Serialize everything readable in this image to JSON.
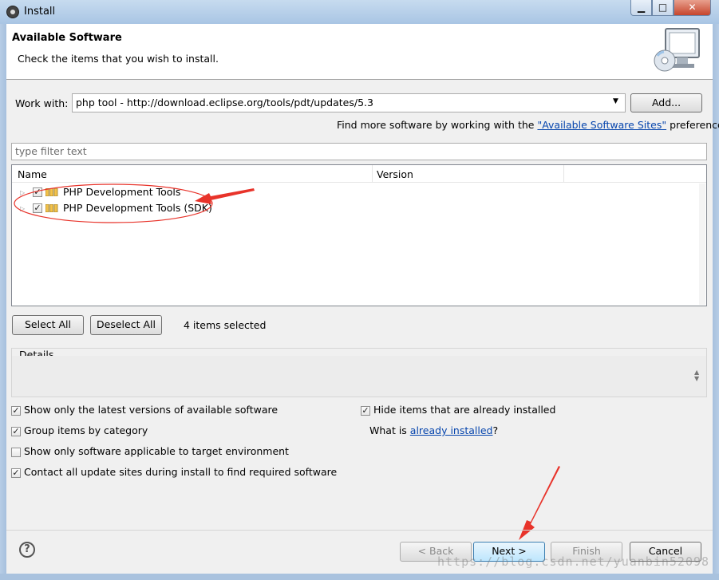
{
  "window": {
    "title": "Install",
    "min_glyph": "▁",
    "max_glyph": "□",
    "close_glyph": "✕"
  },
  "header": {
    "title": "Available Software",
    "subtitle": "Check the items that you wish to install.",
    "icon": "monitor-cd-icon"
  },
  "work_with": {
    "label": "Work with:",
    "value": "php tool - http://download.eclipse.org/tools/pdt/updates/5.3",
    "add_button": "Add...",
    "hint_prefix": "Find more software by working with the",
    "hint_link": "\"Available Software Sites\"",
    "hint_suffix": "preferences."
  },
  "filter": {
    "placeholder": "type filter text"
  },
  "table": {
    "columns": [
      "Name",
      "Version"
    ],
    "rows": [
      {
        "name": "PHP Development Tools",
        "checked": true
      },
      {
        "name": "PHP Development Tools (SDK)",
        "checked": true
      }
    ]
  },
  "selection": {
    "select_all": "Select All",
    "deselect_all": "Deselect All",
    "status": "4 items selected"
  },
  "details": {
    "label": "Details"
  },
  "options": {
    "latest_versions": {
      "label": "Show only the latest versions of available software",
      "checked": true
    },
    "group_by_category": {
      "label": "Group items by category",
      "checked": true
    },
    "target_env": {
      "label": "Show only software applicable to target environment",
      "checked": false
    },
    "contact_sites": {
      "label": "Contact all update sites during install to find required software",
      "checked": true
    },
    "hide_installed": {
      "label": "Hide items that are already installed",
      "checked": true
    },
    "what_is_prefix": "What is",
    "what_is_link": "already installed",
    "what_is_suffix": "?"
  },
  "footer": {
    "help": "?",
    "back": "< Back",
    "next": "Next >",
    "finish": "Finish",
    "cancel": "Cancel"
  },
  "watermark": "https://blog.csdn.net/yuanbin52098",
  "colors": {
    "annotation": "#e8332a",
    "link": "#0645ad",
    "titlebar": "#b7d0ea"
  }
}
